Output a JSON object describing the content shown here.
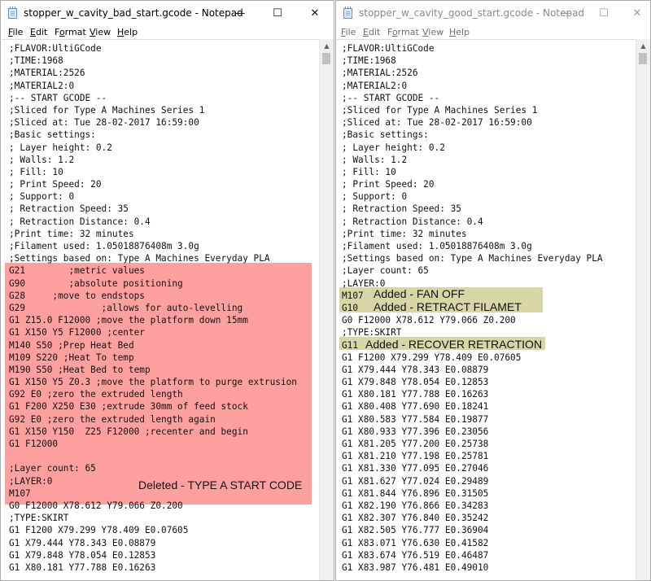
{
  "menu": {
    "file": {
      "key": "F",
      "rest": "ile"
    },
    "edit": {
      "key": "E",
      "rest": "dit"
    },
    "format": {
      "pre": "F",
      "key": "o",
      "rest": "rmat"
    },
    "view": {
      "key": "V",
      "rest": "iew"
    },
    "help": {
      "key": "H",
      "rest": "elp"
    }
  },
  "window_controls": {
    "minimize": "—",
    "maximize": "☐",
    "close": "✕"
  },
  "scrollbar": {
    "up": "▲"
  },
  "left": {
    "title": "stopper_w_cavity_bad_start.gcode - Notepad",
    "lines": [
      ";FLAVOR:UltiGCode",
      ";TIME:1968",
      ";MATERIAL:2526",
      ";MATERIAL2:0",
      ";-- START GCODE --",
      ";Sliced for Type A Machines Series 1",
      ";Sliced at: Tue 28-02-2017 16:59:00",
      ";Basic settings:",
      "; Layer height: 0.2",
      "; Walls: 1.2",
      "; Fill: 10",
      "; Print Speed: 20",
      "; Support: 0",
      "; Retraction Speed: 35",
      "; Retraction Distance: 0.4",
      ";Print time: 32 minutes",
      ";Filament used: 1.05018876408m 3.0g",
      ";Settings based on: Type A Machines Everyday PLA",
      "G21        ;metric values",
      "G90        ;absolute positioning",
      "G28     ;move to endstops",
      "G29              ;allows for auto-levelling",
      "G1 Z15.0 F12000 ;move the platform down 15mm",
      "G1 X150 Y5 F12000 ;center",
      "M140 S50 ;Prep Heat Bed",
      "M109 S220 ;Heat To temp",
      "M190 S50 ;Heat Bed to temp",
      "G1 X150 Y5 Z0.3 ;move the platform to purge extrusion",
      "G92 E0 ;zero the extruded length",
      "G1 F200 X250 E30 ;extrude 30mm of feed stock",
      "G92 E0 ;zero the extruded length again",
      "G1 X150 Y150  Z25 F12000 ;recenter and begin",
      "G1 F12000",
      "",
      ";Layer count: 65",
      ";LAYER:0",
      "M107",
      "G0 F12000 X78.612 Y79.066 Z0.200",
      ";TYPE:SKIRT",
      "G1 F1200 X79.299 Y78.409 E0.07605",
      "G1 X79.444 Y78.343 E0.08879",
      "G1 X79.848 Y78.054 E0.12853",
      "G1 X80.181 Y77.788 E0.16263"
    ],
    "annotation": "Deleted - TYPE A START CODE"
  },
  "right": {
    "title": "stopper_w_cavity_good_start.gcode - Notepad",
    "lines": [
      ";FLAVOR:UltiGCode",
      ";TIME:1968",
      ";MATERIAL:2526",
      ";MATERIAL2:0",
      ";-- START GCODE --",
      ";Sliced for Type A Machines Series 1",
      ";Sliced at: Tue 28-02-2017 16:59:00",
      ";Basic settings:",
      "; Layer height: 0.2",
      "; Walls: 1.2",
      "; Fill: 10",
      "; Print Speed: 20",
      "; Support: 0",
      "; Retraction Speed: 35",
      "; Retraction Distance: 0.4",
      ";Print time: 32 minutes",
      ";Filament used: 1.05018876408m 3.0g",
      ";Settings based on: Type A Machines Everyday PLA",
      ";Layer count: 65",
      ";LAYER:0",
      "M107",
      "G10",
      "G0 F12000 X78.612 Y79.066 Z0.200",
      ";TYPE:SKIRT",
      "G11",
      "G1 F1200 X79.299 Y78.409 E0.07605",
      "G1 X79.444 Y78.343 E0.08879",
      "G1 X79.848 Y78.054 E0.12853",
      "G1 X80.181 Y77.788 E0.16263",
      "G1 X80.408 Y77.690 E0.18241",
      "G1 X80.583 Y77.584 E0.19877",
      "G1 X80.933 Y77.396 E0.23056",
      "G1 X81.205 Y77.200 E0.25738",
      "G1 X81.210 Y77.198 E0.25781",
      "G1 X81.330 Y77.095 E0.27046",
      "G1 X81.627 Y77.024 E0.29489",
      "G1 X81.844 Y76.896 E0.31505",
      "G1 X82.190 Y76.866 E0.34283",
      "G1 X82.307 Y76.840 E0.35242",
      "G1 X82.505 Y76.777 E0.36904",
      "G1 X83.071 Y76.630 E0.41582",
      "G1 X83.674 Y76.519 E0.46487",
      "G1 X83.987 Y76.481 E0.49010"
    ],
    "annotations": {
      "fan_off": "Added - FAN OFF",
      "retract": "Added - RETRACT FILAMET",
      "recover": "Added - RECOVER RETRACTION"
    }
  },
  "colors": {
    "deleted_highlight": "#ffa0a0",
    "added_highlight": "#d6d6a6"
  }
}
